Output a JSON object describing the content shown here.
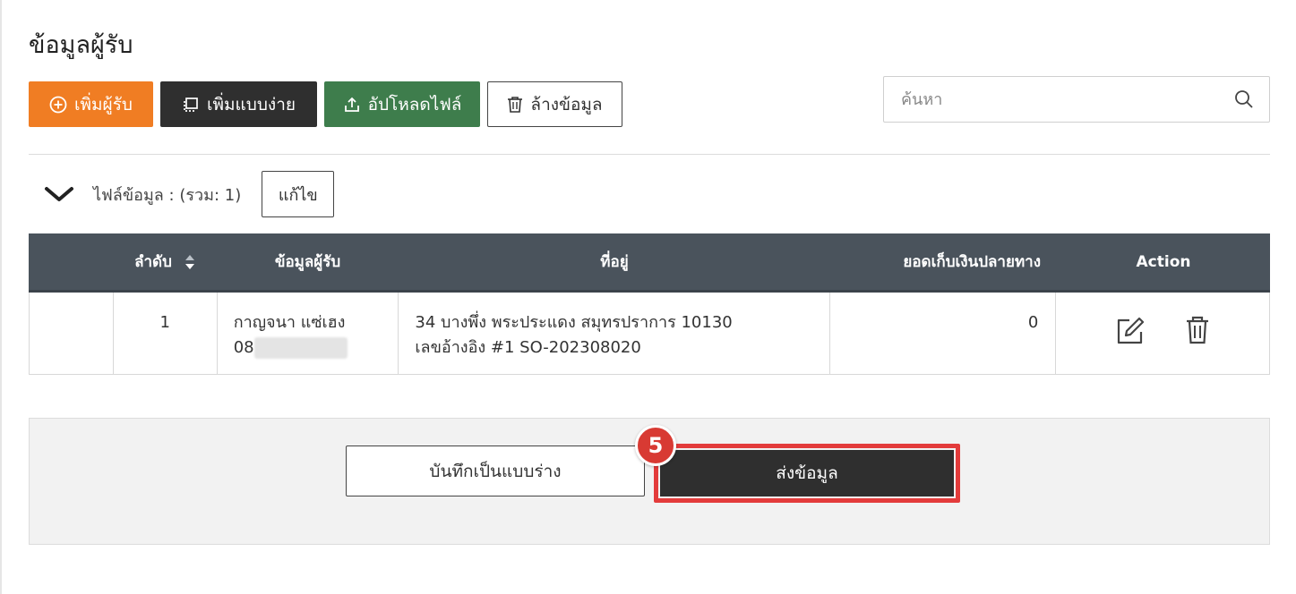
{
  "page": {
    "title": "ข้อมูลผู้รับ"
  },
  "toolbar": {
    "add_recipient": "เพิ่มผู้รับ",
    "add_simple": "เพิ่มแบบง่าย",
    "upload_file": "อัปโหลดไฟล์",
    "clear_data": "ล้างข้อมูล"
  },
  "search": {
    "placeholder": "ค้นหา",
    "value": ""
  },
  "file_section": {
    "label": "ไฟล์ข้อมูล : (รวม: 1)",
    "edit_label": "แก้ไข"
  },
  "table": {
    "headers": [
      "",
      "ลำดับ",
      "ข้อมูลผู้รับ",
      "ที่อยู่",
      "ยอดเก็บเงินปลายทาง",
      "Action"
    ],
    "rows": [
      {
        "index": "1",
        "recipient_name": "กาญจนา แซ่เฮง",
        "recipient_phone": "08",
        "address_line1": "34 บางพึ่ง พระประแดง สมุทรปราการ 10130",
        "address_line2": "เลขอ้างอิง #1 SO-202308020",
        "cod_amount": "0"
      }
    ]
  },
  "footer": {
    "save_draft": "บันทึกเป็นแบบร่าง",
    "submit": "ส่งข้อมูล",
    "step_number": "5"
  },
  "colors": {
    "orange": "#f07d23",
    "dark": "#2f2f2f",
    "green": "#3e7d4c",
    "table_header": "#4a535c",
    "highlight_red": "#e33b3b"
  }
}
